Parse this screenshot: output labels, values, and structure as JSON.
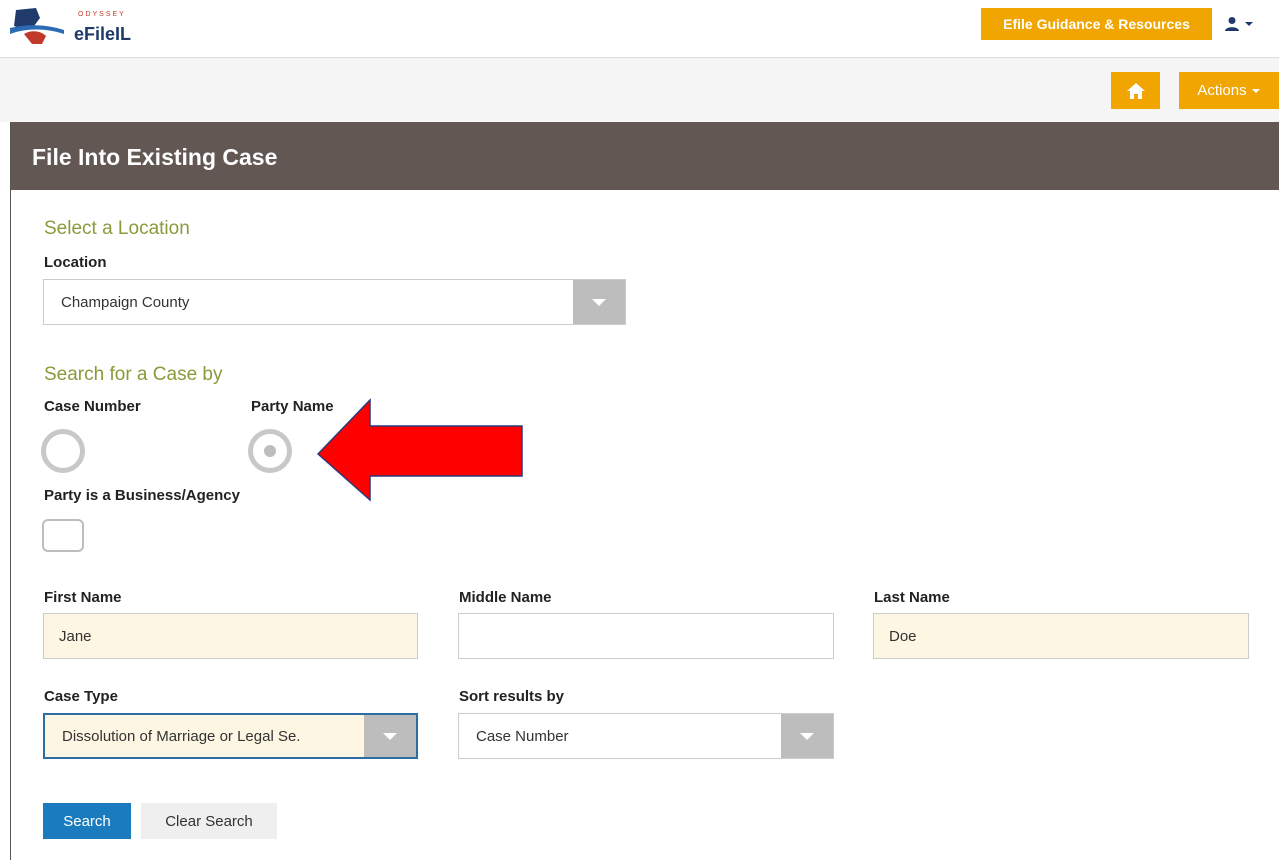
{
  "header": {
    "logo_small": "ODYSSEY",
    "logo_main": "eFileIL",
    "guidance_button": "Efile Guidance & Resources",
    "actions_button": "Actions"
  },
  "panel": {
    "title": "File Into Existing Case"
  },
  "location": {
    "section_title": "Select a Location",
    "label": "Location",
    "value": "Champaign County"
  },
  "search_by": {
    "section_title": "Search for a Case by",
    "options": [
      "Case Number",
      "Party Name"
    ],
    "selected": "Party Name",
    "business_label": "Party is a Business/Agency"
  },
  "name_fields": {
    "first_label": "First Name",
    "first_value": "Jane",
    "middle_label": "Middle Name",
    "middle_value": "",
    "last_label": "Last Name",
    "last_value": "Doe"
  },
  "case_type": {
    "label": "Case Type",
    "value": "Dissolution of Marriage or Legal Se."
  },
  "sort": {
    "label": "Sort results by",
    "value": "Case Number"
  },
  "buttons": {
    "search": "Search",
    "clear": "Clear Search"
  },
  "colors": {
    "accent": "#f0a500",
    "header_bg": "#635753",
    "section_title": "#8a9a3b",
    "primary": "#1b7bbf",
    "annotation_arrow": "#ff0000"
  },
  "icons": {
    "home": "home-icon",
    "user": "user-icon",
    "caret": "chevron-down-icon"
  }
}
